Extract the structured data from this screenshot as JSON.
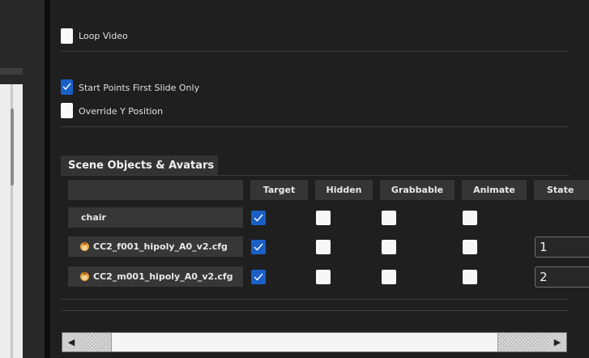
{
  "options": {
    "loop_video": {
      "label": "Loop Video",
      "checked": false
    },
    "start_points_first_slide_only": {
      "label": "Start Points First Slide Only",
      "checked": true
    },
    "override_y_position": {
      "label": "Override Y Position",
      "checked": false
    }
  },
  "scene_objects": {
    "title": "Scene Objects & Avatars",
    "columns": [
      "Target",
      "Hidden",
      "Grabbable",
      "Animate",
      "State"
    ],
    "rows": [
      {
        "name": "chair",
        "icon": "",
        "target": true,
        "hidden": false,
        "grabbable": false,
        "animate": false,
        "state": ""
      },
      {
        "name": "CC2_f001_hipoly_A0_v2.cfg",
        "icon": "avatar-icon",
        "target": true,
        "hidden": false,
        "grabbable": false,
        "animate": false,
        "state": "1"
      },
      {
        "name": "CC2_m001_hipoly_A0_v2.cfg",
        "icon": "avatar-icon",
        "target": true,
        "hidden": false,
        "grabbable": false,
        "animate": false,
        "state": "2"
      }
    ]
  },
  "scrollbar": {
    "left_arrow": "◀",
    "right_arrow": "▶"
  },
  "colors": {
    "accent": "#1a5fc6",
    "background": "#1f1f1f",
    "cell": "#373737"
  }
}
